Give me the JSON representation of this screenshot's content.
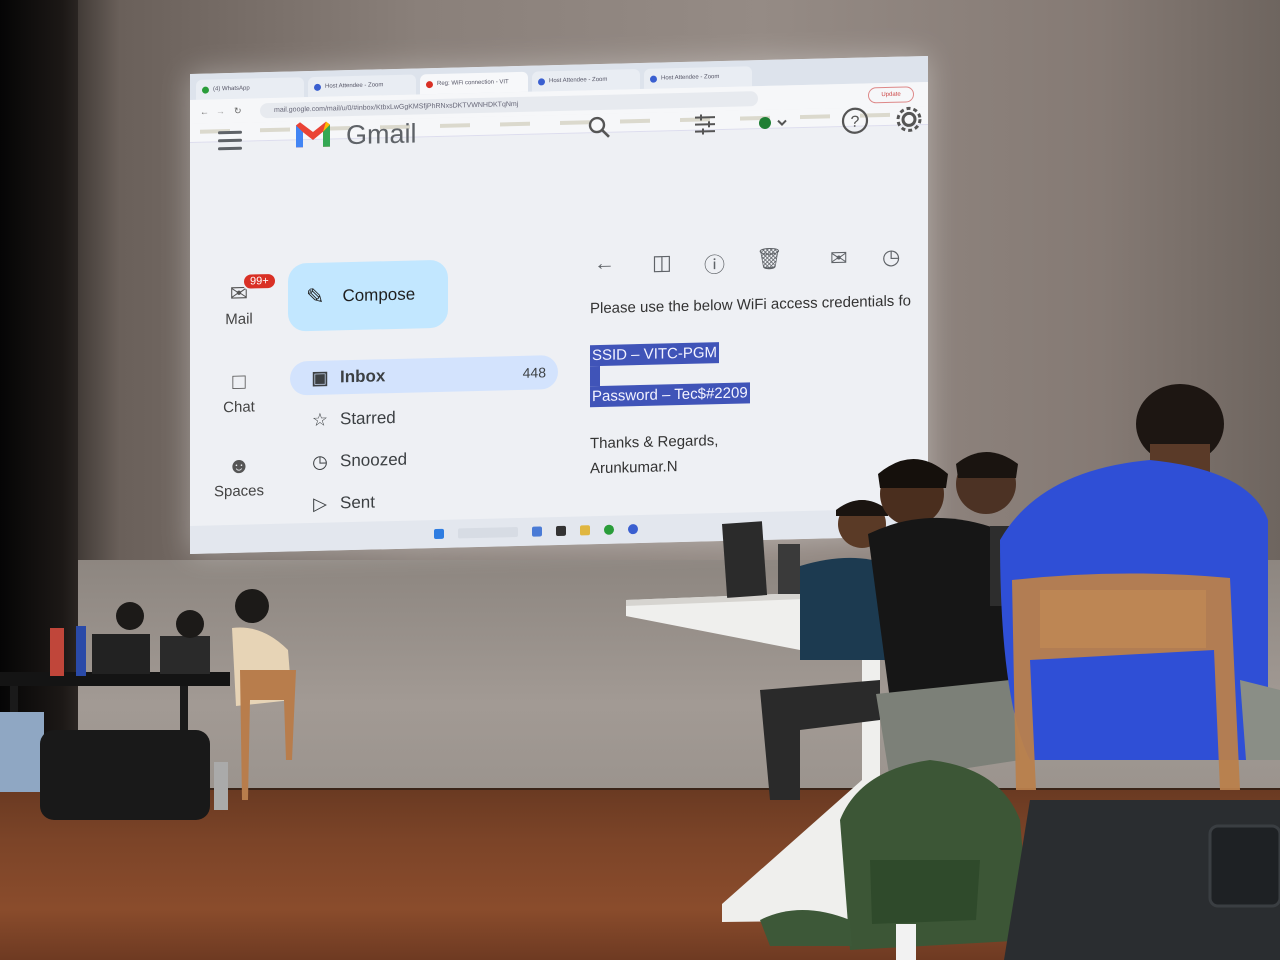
{
  "browser": {
    "tabs": [
      {
        "label": "(4) WhatsApp",
        "active": false
      },
      {
        "label": "Host Attendee - Zoom",
        "active": false
      },
      {
        "label": "Reg: WiFi connection - VIT",
        "active": true
      },
      {
        "label": "Host Attendee - Zoom",
        "active": false
      },
      {
        "label": "Host Attendee - Zoom",
        "active": false
      }
    ],
    "url": "mail.google.com/mail/u/0/#inbox/KtbxLwGgKMSfjPhRNxsDKTVWNHDKTqNmj",
    "update_label": "Update"
  },
  "gmail": {
    "logo_text": "Gmail",
    "rail": {
      "mail_label": "Mail",
      "mail_badge": "99+",
      "chat_label": "Chat",
      "spaces_label": "Spaces"
    },
    "compose_label": "Compose",
    "nav": [
      {
        "label": "Inbox",
        "count": "448",
        "icon": "inbox-icon"
      },
      {
        "label": "Starred",
        "count": "",
        "icon": "star-icon"
      },
      {
        "label": "Snoozed",
        "count": "",
        "icon": "clock-icon"
      },
      {
        "label": "Sent",
        "count": "",
        "icon": "send-icon"
      }
    ],
    "message": {
      "intro": "Please use the below WiFi access credentials fo",
      "ssid_line": "SSID – VITC-PGM",
      "password_line": "Password – Tec$#2209",
      "signoff": "Thanks & Regards,",
      "signature": "Arunkumar.N"
    }
  },
  "colors": {
    "highlight": "#4054b8",
    "compose_bg": "#c2e7ff",
    "active_nav_bg": "#d3e3fd",
    "badge_red": "#d93025",
    "shirt_blue": "#2f4fd6"
  }
}
